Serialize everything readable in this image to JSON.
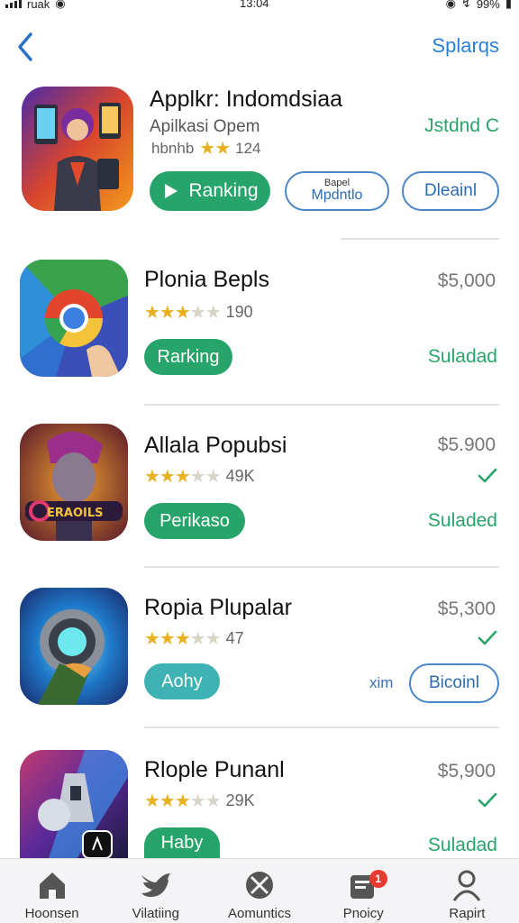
{
  "status_bar": {
    "carrier": "ruak",
    "time": "13:04",
    "battery": "99%"
  },
  "nav": {
    "action_label": "Splarqs",
    "back_icon": "chevron-left-icon"
  },
  "featured": {
    "title": "Applkr: Indomdsiaa",
    "subtitle": "Apilkasi Opem",
    "rating_prefix": "hbnhb",
    "rating_count": "124",
    "status_text": "Jstdnd C",
    "primary_button": "Ranking",
    "secondary_button_top": "Bapel",
    "secondary_button_bottom": "Mpdntlo",
    "tertiary_button": "Dleainl"
  },
  "apps": [
    {
      "title": "Plonia Bepls",
      "rating_count": "190",
      "stars": 3.5,
      "price": "$5,000",
      "button": "Rarking",
      "button_style": "green",
      "status_text": "Suladad",
      "checked": false
    },
    {
      "title": "Allala Popubsi",
      "rating_count": "49K",
      "stars": 2.5,
      "price": "$5.900",
      "button": "Perikaso",
      "button_style": "green",
      "status_text": "Suladed",
      "checked": true
    },
    {
      "title": "Ropia Plupalar",
      "rating_count": "47",
      "stars": 2.5,
      "price": "$5,300",
      "button": "Aohy",
      "button_style": "teal",
      "status_text": "Bicoinl",
      "extra_text": "xim",
      "checked": true
    },
    {
      "title": "Rlople Punanl",
      "rating_count": "29K",
      "stars": 3.5,
      "price": "$5,900",
      "button": "Haby",
      "button_style": "green",
      "status_text": "Suladad",
      "checked": true
    }
  ],
  "tabs": [
    {
      "label": "Hoonsen",
      "icon": "home-icon"
    },
    {
      "label": "Vilatiing",
      "icon": "bird-icon"
    },
    {
      "label": "Aomuntics",
      "icon": "compass-icon"
    },
    {
      "label": "Pnoicy",
      "icon": "inbox-icon",
      "badge": "1"
    },
    {
      "label": "Rapirt",
      "icon": "person-icon"
    }
  ],
  "colors": {
    "accent_blue": "#2a7fd6",
    "accent_green": "#27a46a",
    "accent_teal": "#3fb3b3",
    "star": "#e8b020",
    "badge_red": "#e53a2f"
  }
}
